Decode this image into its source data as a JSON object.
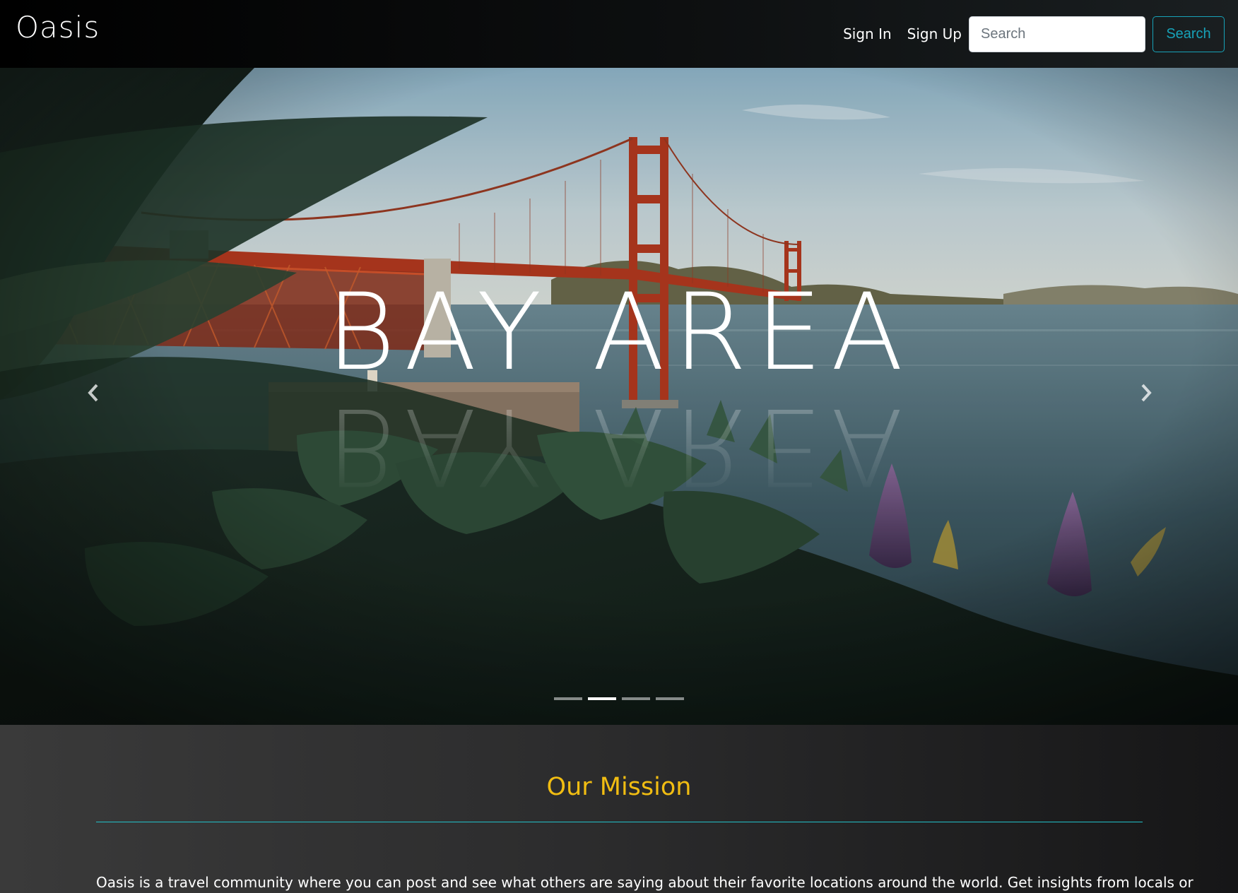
{
  "navbar": {
    "brand": "Oasis",
    "sign_in": "Sign In",
    "sign_up": "Sign Up",
    "search_placeholder": "Search",
    "search_button": "Search"
  },
  "hero": {
    "title": "BAY AREA",
    "prev_icon": "chevron-left-icon",
    "next_icon": "chevron-right-icon",
    "slide_count": 4,
    "active_slide": 2
  },
  "mission": {
    "title": "Our Mission",
    "text": "Oasis is a travel community where you can post and see what others are saying about their favorite locations around the world. Get insights from locals or"
  },
  "colors": {
    "accent_teal": "#17a2b8",
    "mission_title": "#f1bd12",
    "divider": "#22c1c9",
    "bridge": "#b4391f"
  }
}
